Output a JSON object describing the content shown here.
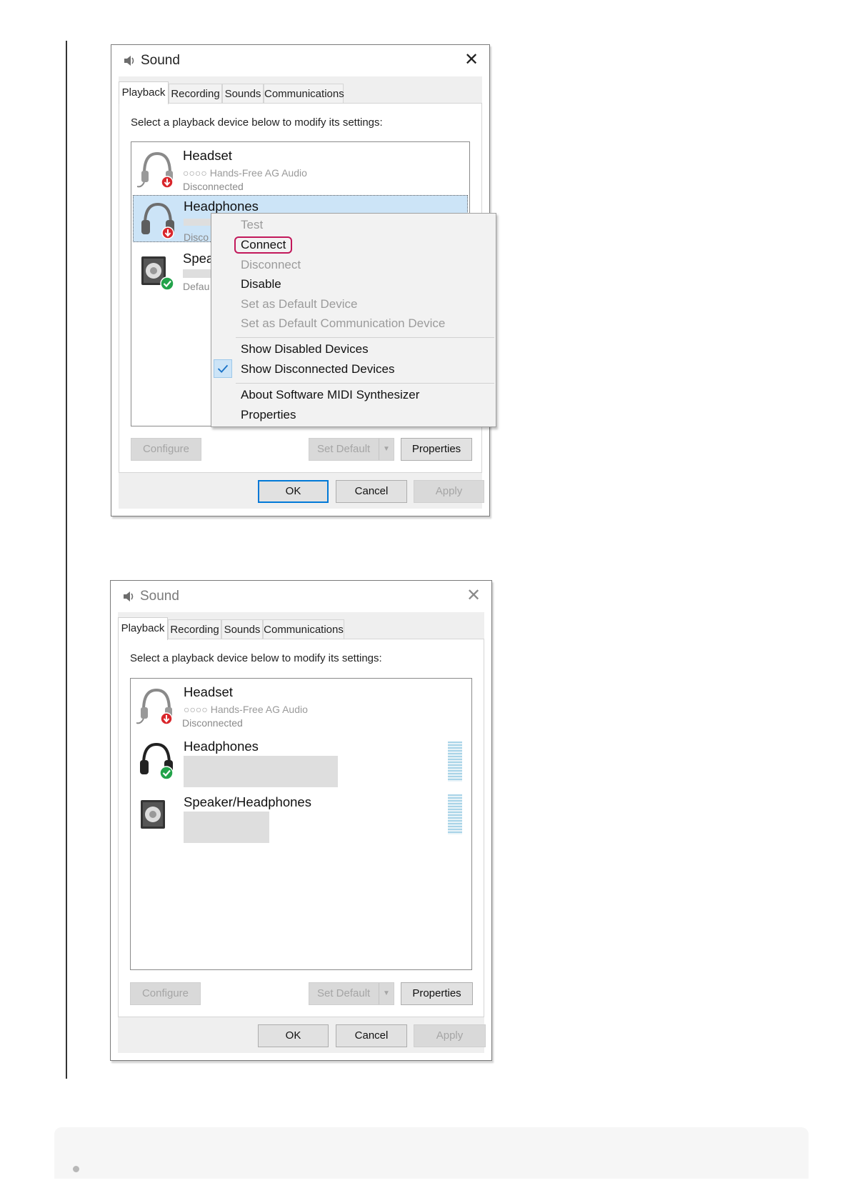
{
  "dialog_title": "Sound",
  "tabs": [
    "Playback",
    "Recording",
    "Sounds",
    "Communications"
  ],
  "instruction": "Select a playback device below to modify its settings:",
  "dialog1": {
    "devices": [
      {
        "name": "Headset",
        "sub": "○○○○ Hands-Free AG Audio",
        "status": "Disconnected",
        "icon": "headset-disconnected-icon"
      },
      {
        "name": "Headphones",
        "status": "Disco",
        "icon": "headphones-disconnected-icon",
        "selected": true
      },
      {
        "name": "Spea",
        "status": "Defau",
        "icon": "speaker-default-icon"
      }
    ]
  },
  "context_menu": {
    "items": [
      {
        "label": "Test",
        "enabled": false
      },
      {
        "label": "Connect",
        "enabled": true,
        "highlighted": true
      },
      {
        "label": "Disconnect",
        "enabled": false
      },
      {
        "label": "Disable",
        "enabled": true
      },
      {
        "label": "Set as Default Device",
        "enabled": false
      },
      {
        "label": "Set as Default Communication Device",
        "enabled": false
      },
      {
        "label": "Show Disabled Devices",
        "enabled": true
      },
      {
        "label": "Show Disconnected Devices",
        "enabled": true,
        "checked": true
      },
      {
        "label": "About Software MIDI Synthesizer",
        "enabled": true
      },
      {
        "label": "Properties",
        "enabled": true
      }
    ]
  },
  "dialog2": {
    "devices": [
      {
        "name": "Headset",
        "sub": "○○○○ Hands-Free AG Audio",
        "status": "Disconnected",
        "icon": "headset-disconnected-icon"
      },
      {
        "name": "Headphones",
        "icon": "headphones-connected-icon"
      },
      {
        "name": "Speaker/Headphones",
        "icon": "speaker-icon"
      }
    ]
  },
  "buttons": {
    "configure": "Configure",
    "set_default": "Set Default",
    "properties": "Properties",
    "ok": "OK",
    "cancel": "Cancel",
    "apply": "Apply"
  },
  "colors": {
    "accent": "#0078d7",
    "selection": "#cce4f7",
    "connect_highlight": "#c2185b",
    "status_ok": "#22a34a",
    "status_disconnected": "#d9262b"
  }
}
